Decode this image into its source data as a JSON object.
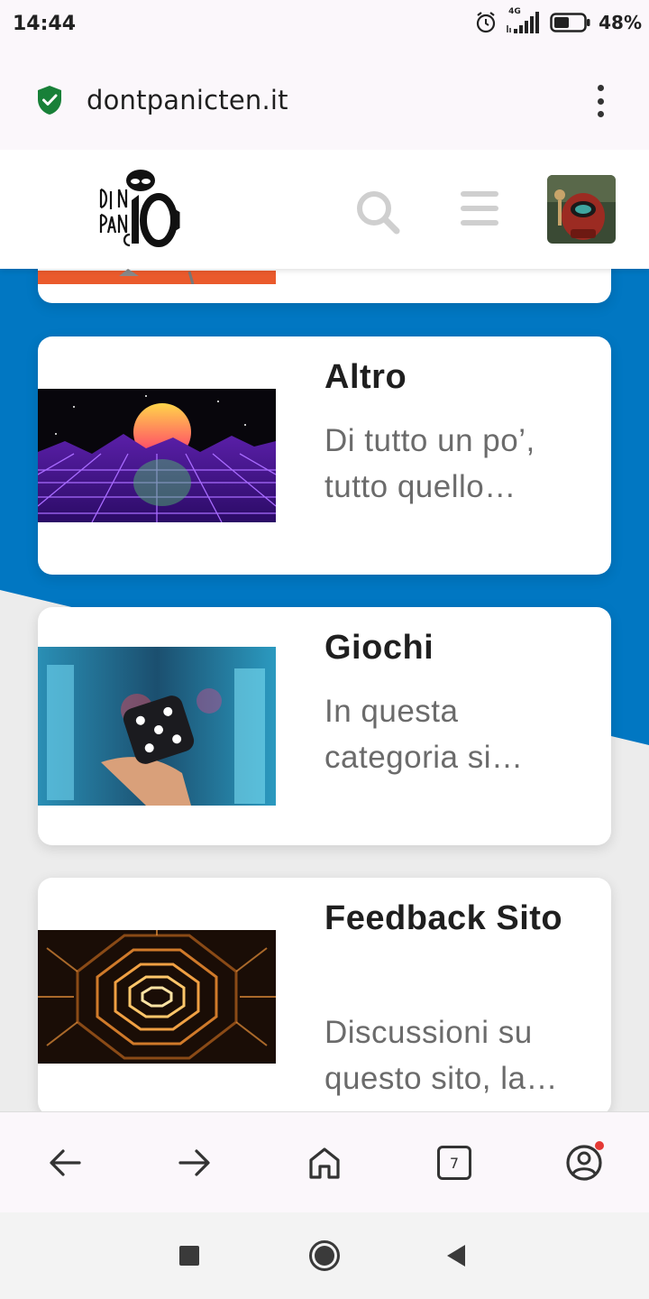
{
  "status": {
    "time": "14:44",
    "network": "4G",
    "battery": "48%"
  },
  "browser": {
    "url": "dontpanicten.it",
    "tab_count": "7"
  },
  "site": {
    "logo_alt": "Don't Panic 10"
  },
  "cards": [
    {
      "title": "Altro",
      "description": "Di tutto un po’, tutto quello…"
    },
    {
      "title": "Giochi",
      "description": "In questa categoria si…"
    },
    {
      "title": "Feedback Sito",
      "description": "Discussioni su questo sito, la…"
    }
  ],
  "icons": {
    "url_secure": "shield-check-icon",
    "browser_menu": "more-vert-icon",
    "site_search": "search-icon",
    "site_menu": "hamburger-icon",
    "back": "arrow-left-icon",
    "forward": "arrow-right-icon",
    "home": "home-icon",
    "account": "account-icon"
  },
  "colors": {
    "page_blue": "#0177c2",
    "shield_green": "#188038",
    "notification_red": "#e53935"
  }
}
